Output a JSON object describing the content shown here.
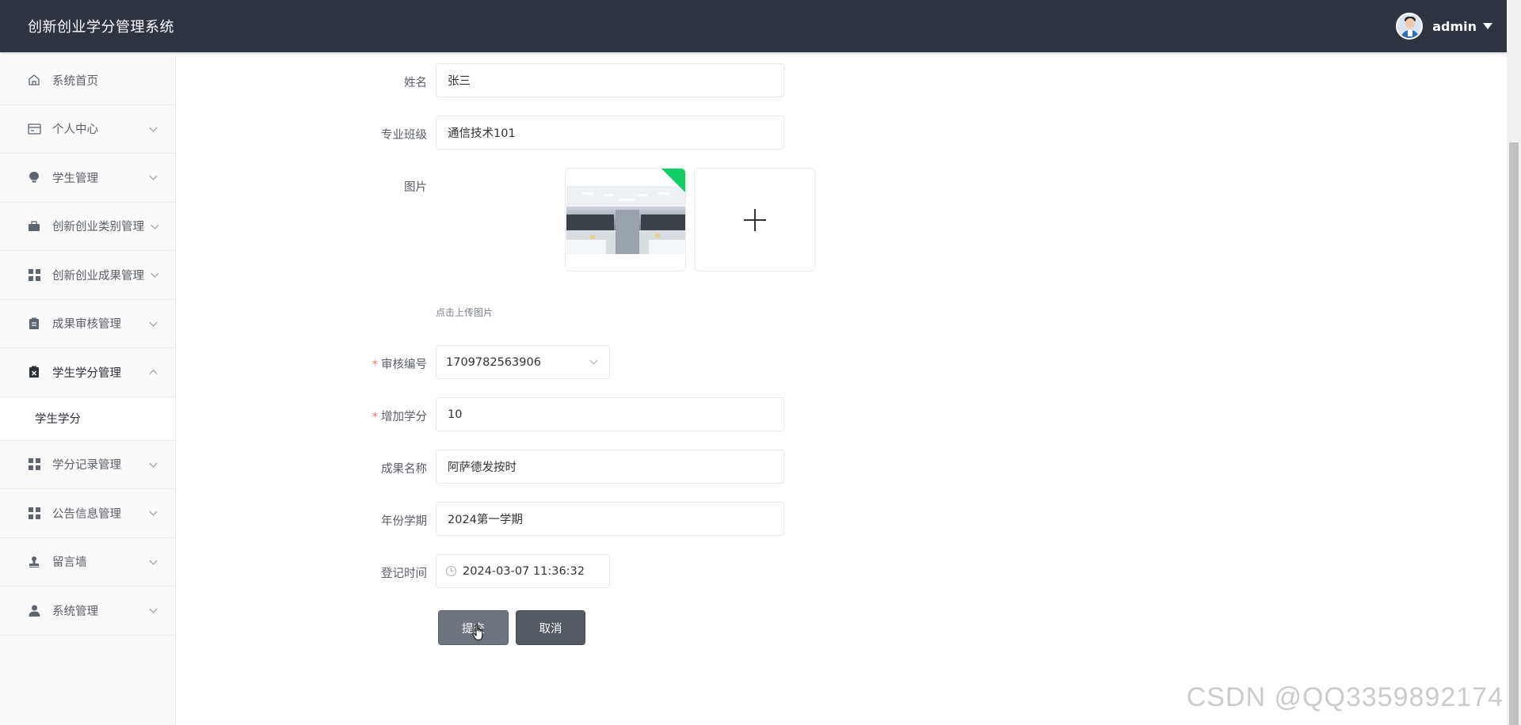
{
  "header": {
    "title": "创新创业学分管理系统",
    "username": "admin"
  },
  "sidebar": {
    "items": [
      {
        "label": "系统首页",
        "icon": "home-icon"
      },
      {
        "label": "个人中心",
        "icon": "id-card-icon"
      },
      {
        "label": "学生管理",
        "icon": "bulb-icon"
      },
      {
        "label": "创新创业类别管理",
        "icon": "briefcase-icon"
      },
      {
        "label": "创新创业成果管理",
        "icon": "grid-icon"
      },
      {
        "label": "成果审核管理",
        "icon": "clipboard-icon"
      },
      {
        "label": "学生学分管理",
        "icon": "clipboard-x-icon",
        "expanded": true
      },
      {
        "label": "学分记录管理",
        "icon": "grid-icon"
      },
      {
        "label": "公告信息管理",
        "icon": "grid-icon"
      },
      {
        "label": "留言墙",
        "icon": "stamp-icon"
      },
      {
        "label": "系统管理",
        "icon": "user-icon"
      }
    ],
    "submenu": {
      "label": "学生学分"
    }
  },
  "form": {
    "name": {
      "label": "姓名",
      "value": "张三"
    },
    "class": {
      "label": "专业班级",
      "value": "通信技术101"
    },
    "image": {
      "label": "图片",
      "hint": "点击上传图片"
    },
    "audit_no": {
      "label": "审核编号",
      "value": "1709782563906",
      "required": true
    },
    "credit": {
      "label": "增加学分",
      "value": "10",
      "required": true
    },
    "achievement": {
      "label": "成果名称",
      "value": "阿萨德发按时"
    },
    "term": {
      "label": "年份学期",
      "value": "2024第一学期"
    },
    "register_time": {
      "label": "登记时间",
      "value": "2024-03-07 11:36:32"
    }
  },
  "buttons": {
    "submit": "提交",
    "cancel": "取消"
  },
  "watermark": "CSDN @QQ3359892174",
  "colors": {
    "header_bg": "#2e3540",
    "sidebar_bg": "#fafafa",
    "button_submit": "#6d747d",
    "button_cancel": "#535a62",
    "required": "#f56c6c",
    "success_corner": "#13ce66"
  }
}
